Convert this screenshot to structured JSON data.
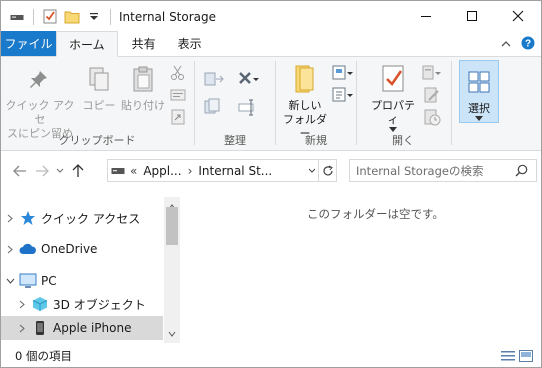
{
  "window": {
    "title": "Internal Storage"
  },
  "tabs": {
    "file": "ファイル",
    "home": "ホーム",
    "share": "共有",
    "view": "表示"
  },
  "ribbon": {
    "clipboard": {
      "label": "クリップボード",
      "pin_line1": "クイック アクセ",
      "pin_line2": "スにピン留め",
      "copy": "コピー",
      "paste": "貼り付け"
    },
    "organize": {
      "label": "整理"
    },
    "new": {
      "label": "新規",
      "folder_line1": "新しい",
      "folder_line2": "フォルダー"
    },
    "open": {
      "label": "開く",
      "properties": "プロパティ"
    },
    "select": {
      "label": "選択"
    }
  },
  "address": {
    "prefix": "«",
    "crumb1": "Appl...",
    "crumb2": "Internal St...",
    "search_placeholder": "Internal Storageの検索"
  },
  "nav": {
    "items": [
      {
        "label": "クイック アクセス"
      },
      {
        "label": "OneDrive"
      },
      {
        "label": "PC"
      },
      {
        "label": "3D オブジェクト"
      },
      {
        "label": "Apple iPhone"
      }
    ]
  },
  "content": {
    "empty_message": "このフォルダーは空です。"
  },
  "status": {
    "item_count": "0 個の項目"
  },
  "colors": {
    "accent": "#1979ca",
    "selected_nav": "#d9d9d9",
    "ribbon_bg": "#f5f6f7",
    "select_button": "#cce4f7"
  }
}
